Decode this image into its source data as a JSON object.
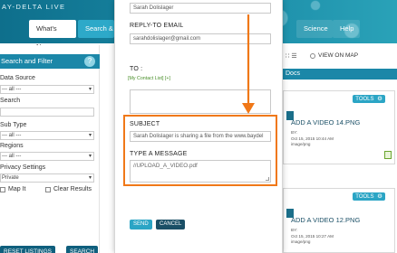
{
  "banner": {
    "brand": "AY-DELTA LIVE"
  },
  "nav": {
    "whats_new": "What's New",
    "search": "Search & Li",
    "science": "Science",
    "help": "Help"
  },
  "sidebar": {
    "title": "Search and Filter",
    "help_glyph": "?",
    "data_source_label": "Data Source",
    "data_source_value": "--- all ---",
    "search_label": "Search",
    "sub_type_label": "Sub Type",
    "sub_type_value": "--- all ---",
    "regions_label": "Regions",
    "regions_value": "--- all ---",
    "privacy_label": "Privacy Settings",
    "privacy_value": "Private",
    "map_it_label": "Map It",
    "clear_results_label": "Clear Results",
    "reset_button": "RESET LISTINGS",
    "search_button": "SEARCH"
  },
  "results": {
    "view_on_map": "VIEW ON MAP",
    "view_icons": "∷ ☰",
    "header": "Docs",
    "tools_label": "TOOLS",
    "gear_glyph": "⚙",
    "cards": [
      {
        "title": "ADD A VIDEO 14.PNG",
        "meta_by": "BY:",
        "meta_date": "Oct 15, 2015 10:44 AM",
        "meta_type": "image/png"
      },
      {
        "title": "ADD A VIDEO 12.PNG",
        "meta_by": "BY:",
        "meta_date": "Oct 15, 2015 10:27 AM",
        "meta_type": "image/png"
      }
    ]
  },
  "modal": {
    "from_name_value": "Sarah Dolislager",
    "reply_to_label": "REPLY-TO EMAIL",
    "reply_to_value": "sarahdolislager@gmail.com",
    "to_label": "TO :",
    "contact_list_link": "[My Contact List] [+]",
    "subject_label": "SUBJECT",
    "subject_value": "Sarah Dolislager is sharing a file from the www.baydel",
    "message_label": "TYPE A MESSAGE",
    "message_value": "//UPLOAD_A_VIDEO.pdf",
    "send_button": "SEND",
    "cancel_button": "CANCEL"
  },
  "colors": {
    "accent": "#2ba5c5",
    "dark": "#1a4f66",
    "annotation": "#f07818",
    "link": "#4a8f2a"
  }
}
